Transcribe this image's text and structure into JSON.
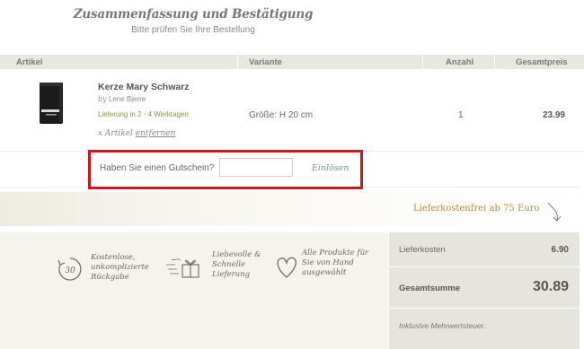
{
  "header": {
    "title": "Zusammenfassung und Bestätigung",
    "subtitle": "Bitte prüfen Sie Ihre Bestellung"
  },
  "table": {
    "columns": [
      "Artikel",
      "Variante",
      "Anzahl",
      "Gesamtpreis"
    ]
  },
  "product": {
    "name": "Kerze Mary Schwarz",
    "by_prefix": "by",
    "by_name": "Lene Bjerre",
    "delivery": "Lieferung in 2 - 4 Werktagen",
    "remove_prefix": "x Artikel",
    "remove_link": "entfernen",
    "variant": "Größe: H 20 cm",
    "quantity": "1",
    "total": "23.99"
  },
  "voucher": {
    "label": "Haben Sie einen Gutschein?",
    "input_value": "",
    "redeem": "Einlösen"
  },
  "banner": {
    "text": "Lieferkostenfrei ab 75 Euro"
  },
  "features": [
    {
      "icon": "return-30-icon",
      "lines": [
        "Kostenlose,",
        "unkomplizierte",
        "Rückgabe"
      ]
    },
    {
      "icon": "gift-icon",
      "lines": [
        "Liebevolle &",
        "Schnelle",
        "Lieferung"
      ]
    },
    {
      "icon": "heart-icon",
      "lines": [
        "Alle Produkte für",
        "Sie von Hand",
        "ausgewählt"
      ]
    }
  ],
  "return_icon_label": "30",
  "summary": {
    "shipping_label": "Lieferkosten",
    "shipping_value": "6.90",
    "total_label": "Gesamtsumme",
    "total_value": "30.89",
    "vat_note": "Inklusive Mehrwertsteuer."
  },
  "colors": {
    "voucher_highlight": "#d0161e",
    "banner_text": "#b8893e",
    "delivery_text": "#7a9a4a"
  }
}
